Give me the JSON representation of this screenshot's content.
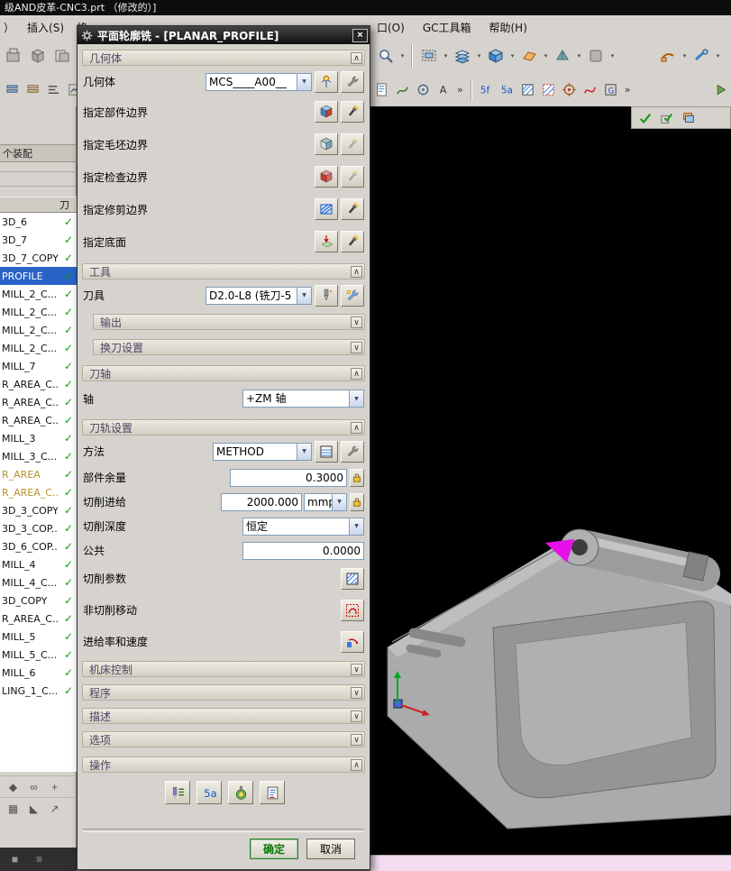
{
  "window": {
    "title": "级AND皮革-CNC3.prt  （修改的）]"
  },
  "menubar": {
    "items_left": [
      "）",
      "插入(S)",
      "格"
    ],
    "items_right": [
      "口(O)",
      "GC工具箱",
      "帮助(H)"
    ]
  },
  "navigator": {
    "tab_label": "个装配",
    "column_header": "刀"
  },
  "tree": {
    "items": [
      {
        "label": "3D_6"
      },
      {
        "label": "3D_7"
      },
      {
        "label": "3D_7_COPY"
      },
      {
        "label": "PROFILE",
        "selected": true
      },
      {
        "label": "MILL_2_C..."
      },
      {
        "label": "MILL_2_C..."
      },
      {
        "label": "MILL_2_C..."
      },
      {
        "label": "MILL_2_C..."
      },
      {
        "label": "MILL_7"
      },
      {
        "label": "R_AREA_C..."
      },
      {
        "label": "R_AREA_C..."
      },
      {
        "label": "R_AREA_C..."
      },
      {
        "label": "MILL_3"
      },
      {
        "label": "MILL_3_C..."
      },
      {
        "label": "R_AREA",
        "gold": true
      },
      {
        "label": "R_AREA_C...",
        "gold": true
      },
      {
        "label": "3D_3_COPY"
      },
      {
        "label": "3D_3_COP..."
      },
      {
        "label": "3D_6_COP..."
      },
      {
        "label": "MILL_4"
      },
      {
        "label": "MILL_4_C..."
      },
      {
        "label": "3D_COPY"
      },
      {
        "label": "R_AREA_C..."
      },
      {
        "label": "MILL_5"
      },
      {
        "label": "MILL_5_C..."
      },
      {
        "label": "MILL_6"
      },
      {
        "label": "LING_1_C..."
      }
    ]
  },
  "toolbar_icon_names": {
    "left_row1": [
      "cad-icon-a",
      "cad-icon-b",
      "cad-icon-c",
      "cad-icon-d"
    ],
    "left_row2": [
      "cad-icon-e",
      "cad-icon-f",
      "cad-icon-g",
      "cad-icon-h"
    ],
    "right_row1": [
      "zoom",
      "section-view",
      "work-layer",
      "shaded-display",
      "datum-plane",
      "view-orient",
      "background",
      "clip-a",
      "clip-b"
    ],
    "right_row2": [
      "list-doc",
      "profile-curve",
      "point-circle",
      "text",
      "show-5f",
      "show-5a",
      "hatch-a",
      "hatch-b",
      "circle-dot",
      "spline",
      "group-box",
      "replay"
    ],
    "right_row3": [
      "accept-check",
      "apply-check",
      "layer-stack"
    ]
  },
  "dialog": {
    "title": "平面轮廓铣 - [PLANAR_PROFILE]",
    "geometry": {
      "header": "几何体",
      "mcs_label": "几何体",
      "mcs_value": "MCS____A00__",
      "rows": [
        {
          "label": "指定部件边界"
        },
        {
          "label": "指定毛坯边界"
        },
        {
          "label": "指定检查边界"
        },
        {
          "label": "指定修剪边界"
        },
        {
          "label": "指定底面"
        }
      ]
    },
    "tool": {
      "header": "工具",
      "tool_label": "刀具",
      "tool_value": "D2.0-L8 (铣刀-5",
      "collapsed": [
        "输出",
        "换刀设置"
      ]
    },
    "axis": {
      "header": "刀轴",
      "axis_label": "轴",
      "axis_value": "+ZM 轴"
    },
    "path": {
      "header": "刀轨设置",
      "method_label": "方法",
      "method_value": "METHOD",
      "stock_label": "部件余量",
      "stock_value": "0.3000",
      "feed_label": "切削进给",
      "feed_value": "2000.000",
      "feed_unit": "mmpm",
      "depth_label": "切削深度",
      "depth_value": "恒定",
      "common_label": "公共",
      "common_value": "0.0000",
      "cut_params_label": "切削参数",
      "non_cutting_label": "非切削移动",
      "feeds_label": "进给率和速度"
    },
    "collapsed_groups": [
      "机床控制",
      "程序",
      "描述",
      "选项"
    ],
    "actions_header": "操作",
    "ok": "确定",
    "cancel": "取消"
  },
  "colors": {
    "selection_blue": "#2a63c8",
    "tree_gold": "#b8922f",
    "check_green": "#129c12",
    "status_pink": "#f3ddf0",
    "viewport_bg": "#000000",
    "magenta_marker": "#e810e8"
  }
}
